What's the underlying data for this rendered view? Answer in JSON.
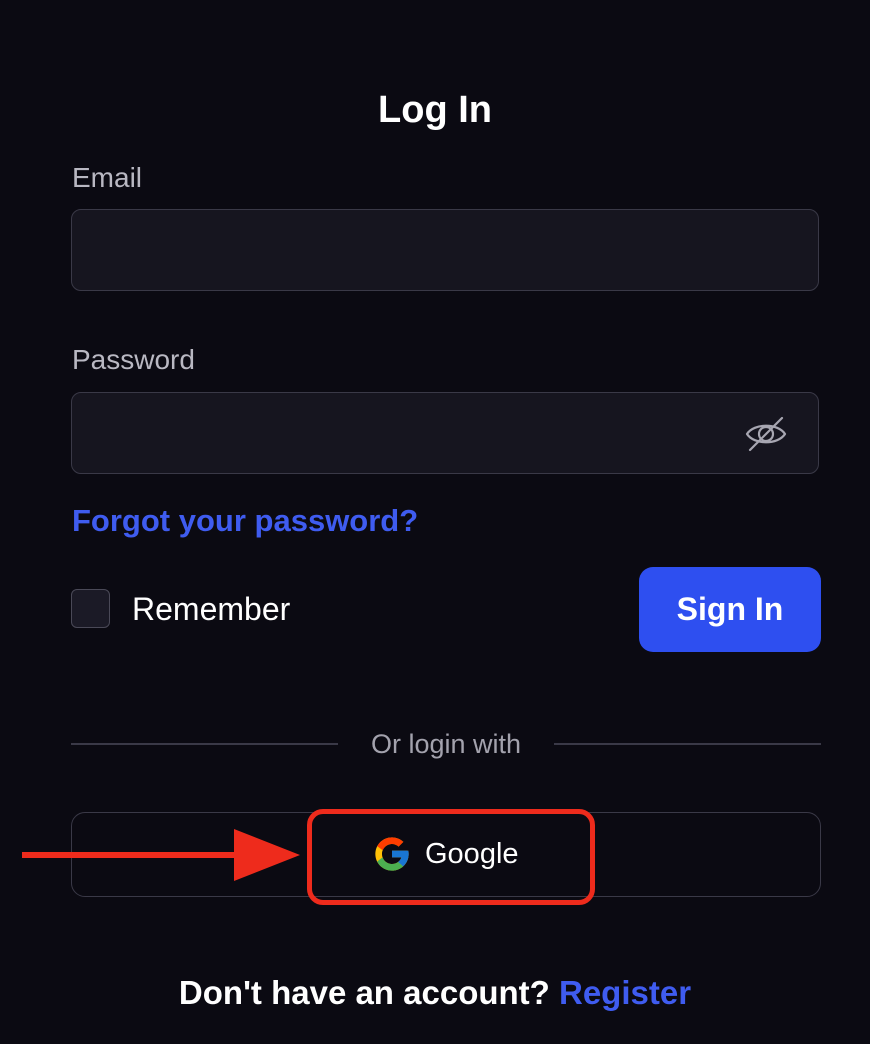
{
  "title": "Log In",
  "email": {
    "label": "Email",
    "value": "",
    "placeholder": ""
  },
  "password": {
    "label": "Password",
    "value": "",
    "placeholder": "",
    "toggle_icon": "eye-off-icon"
  },
  "forgot_password": "Forgot your password?",
  "remember": {
    "label": "Remember",
    "checked": false
  },
  "sign_in_label": "Sign In",
  "divider_text": "Or login with",
  "google": {
    "label": "Google",
    "icon": "google-logo-icon"
  },
  "footer": {
    "prompt": "Don't have an account?",
    "register_label": "Register"
  },
  "annotation": {
    "color": "#ee2b1c",
    "arrow_icon": "arrow-right-icon"
  },
  "colors": {
    "background": "#0b0a12",
    "accent": "#2e4ff0",
    "link": "#3f5cf0",
    "field_bg": "#16151f",
    "border": "#3a3947"
  }
}
